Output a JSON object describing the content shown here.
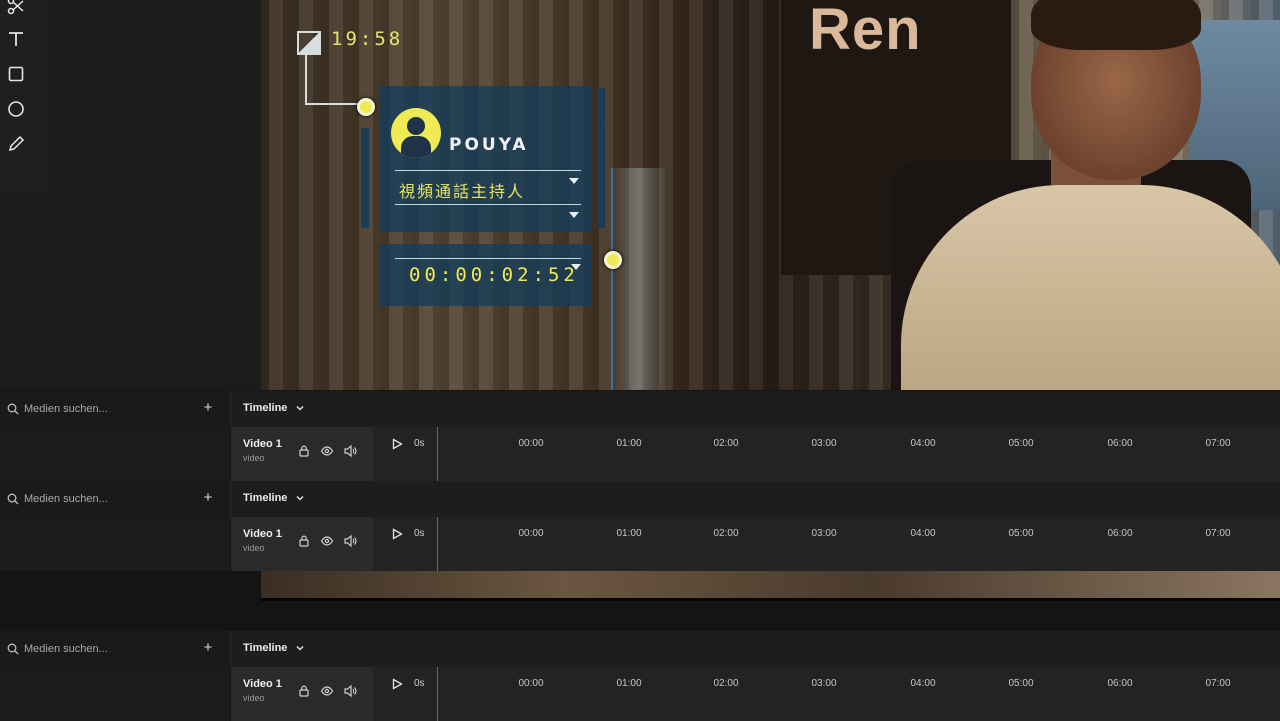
{
  "toolbar": {
    "tools": [
      "scissors-icon",
      "text-icon",
      "rectangle-icon",
      "circle-icon",
      "pen-icon"
    ]
  },
  "preview": {
    "sign_text": "Ren",
    "hud": {
      "time": "19:58",
      "name": "POUYA",
      "role": "視頻通話主持人",
      "timecode": "00:00:02:52",
      "accent_color": "#f0ea54"
    }
  },
  "panels": [
    {
      "search_placeholder": "Medien suchen...",
      "add_label": "+",
      "timeline_title": "Timeline",
      "track_name": "Video 1",
      "track_type": "video",
      "zero_label": "0s",
      "ticks": [
        "00:00",
        "01:00",
        "02:00",
        "03:00",
        "04:00",
        "05:00",
        "06:00",
        "07:00"
      ]
    },
    {
      "search_placeholder": "Medien suchen...",
      "add_label": "+",
      "timeline_title": "Timeline",
      "track_name": "Video 1",
      "track_type": "video",
      "zero_label": "0s",
      "ticks": [
        "00:00",
        "01:00",
        "02:00",
        "03:00",
        "04:00",
        "05:00",
        "06:00",
        "07:00"
      ]
    },
    {
      "search_placeholder": "Medien suchen...",
      "add_label": "+",
      "timeline_title": "Timeline",
      "track_name": "Video 1",
      "track_type": "video",
      "zero_label": "0s",
      "ticks": [
        "00:00",
        "01:00",
        "02:00",
        "03:00",
        "04:00",
        "05:00",
        "06:00",
        "07:00"
      ]
    }
  ],
  "colors": {
    "background": "#141414",
    "panel": "#1d1d1d",
    "playhead": "#3a6ea5"
  }
}
